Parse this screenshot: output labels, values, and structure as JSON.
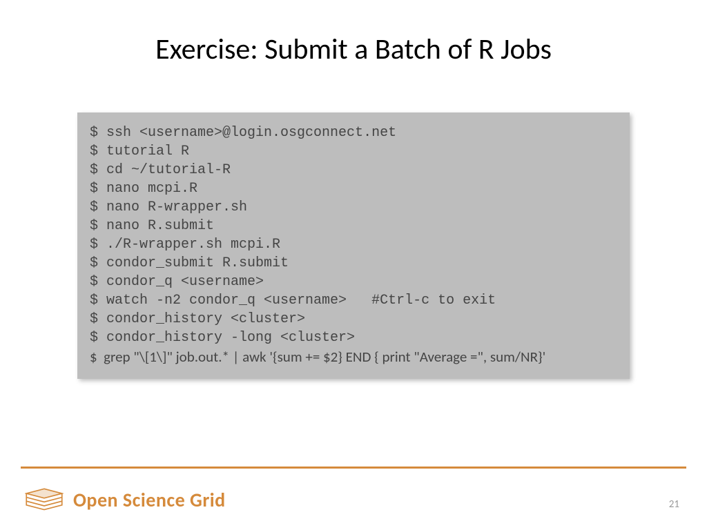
{
  "title": "Exercise: Submit a Batch of R Jobs",
  "terminal": {
    "lines": [
      "$ ssh <username>@login.osgconnect.net",
      "$ tutorial R",
      "$ cd ~/tutorial-R",
      "$ nano mcpi.R",
      "$ nano R-wrapper.sh",
      "$ nano R.submit",
      "$ ./R-wrapper.sh mcpi.R",
      "$ condor_submit R.submit",
      "$ condor_q <username>",
      "$ watch -n2 condor_q <username>   #Ctrl-c to exit",
      "$ condor_history <cluster>",
      "$ condor_history -long <cluster>"
    ],
    "last_line": "$  grep \"\\[1\\]\" job.out.* | awk '{sum += $2} END { print \"Average =\", sum/NR}'"
  },
  "footer": {
    "brand": "Open Science Grid",
    "page": "21"
  }
}
